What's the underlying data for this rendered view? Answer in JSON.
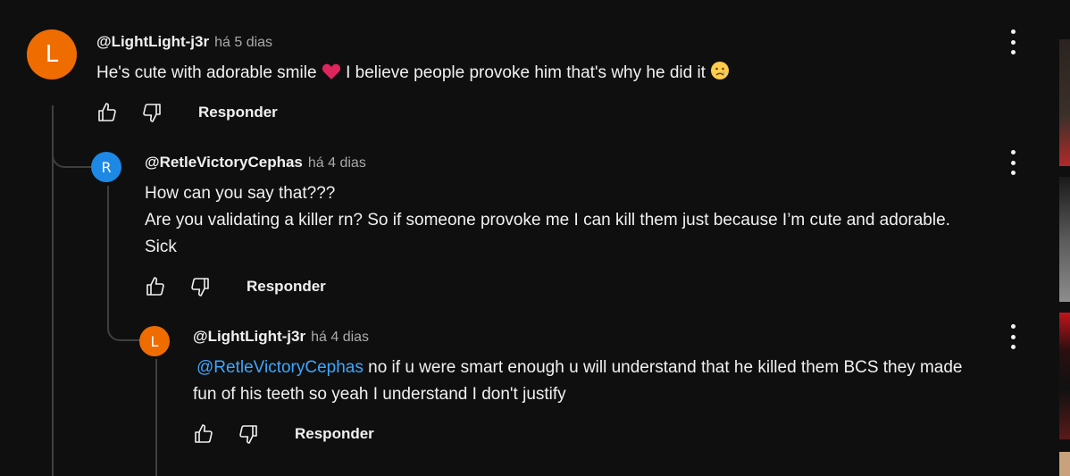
{
  "comments": [
    {
      "avatar_letter": "L",
      "avatar_color": "#ef6c00",
      "author": "@LightLight-j3r",
      "time": "há 5 dias",
      "text_before": "He's cute with adorable smile",
      "text_after": "I believe people provoke him that's why he did it",
      "reply_label": "Responder"
    },
    {
      "avatar_letter": "R",
      "avatar_color": "#1e88e5",
      "author": "@RetleVictoryCephas",
      "time": "há 4 dias",
      "lines": [
        "How can you say that???",
        "Are you validating a killer rn? So if someone provoke me I can kill them just because I’m cute and adorable.",
        "Sick"
      ],
      "reply_label": "Responder"
    },
    {
      "avatar_letter": "L",
      "avatar_color": "#ef6c00",
      "author": "@LightLight-j3r",
      "time": "há 4 dias",
      "mention": "@RetleVictoryCephas",
      "text_line1": "no if u were smart enough u will understand that he killed them BCS they made",
      "text_line2": "fun of his teeth so yeah I understand I don't justify",
      "reply_label": "Responder"
    }
  ],
  "icons": {
    "like": "thumbs-up-icon",
    "dislike": "thumbs-down-icon",
    "menu": "more-vert-icon",
    "heart": "red-heart-emoji",
    "cry": "crying-face-emoji"
  },
  "colors": {
    "background": "#0f0f0f",
    "text": "#f1f1f1",
    "secondary_text": "#aaaaaa",
    "mention": "#3ea6ff",
    "thread_line": "#3f3f3f"
  }
}
